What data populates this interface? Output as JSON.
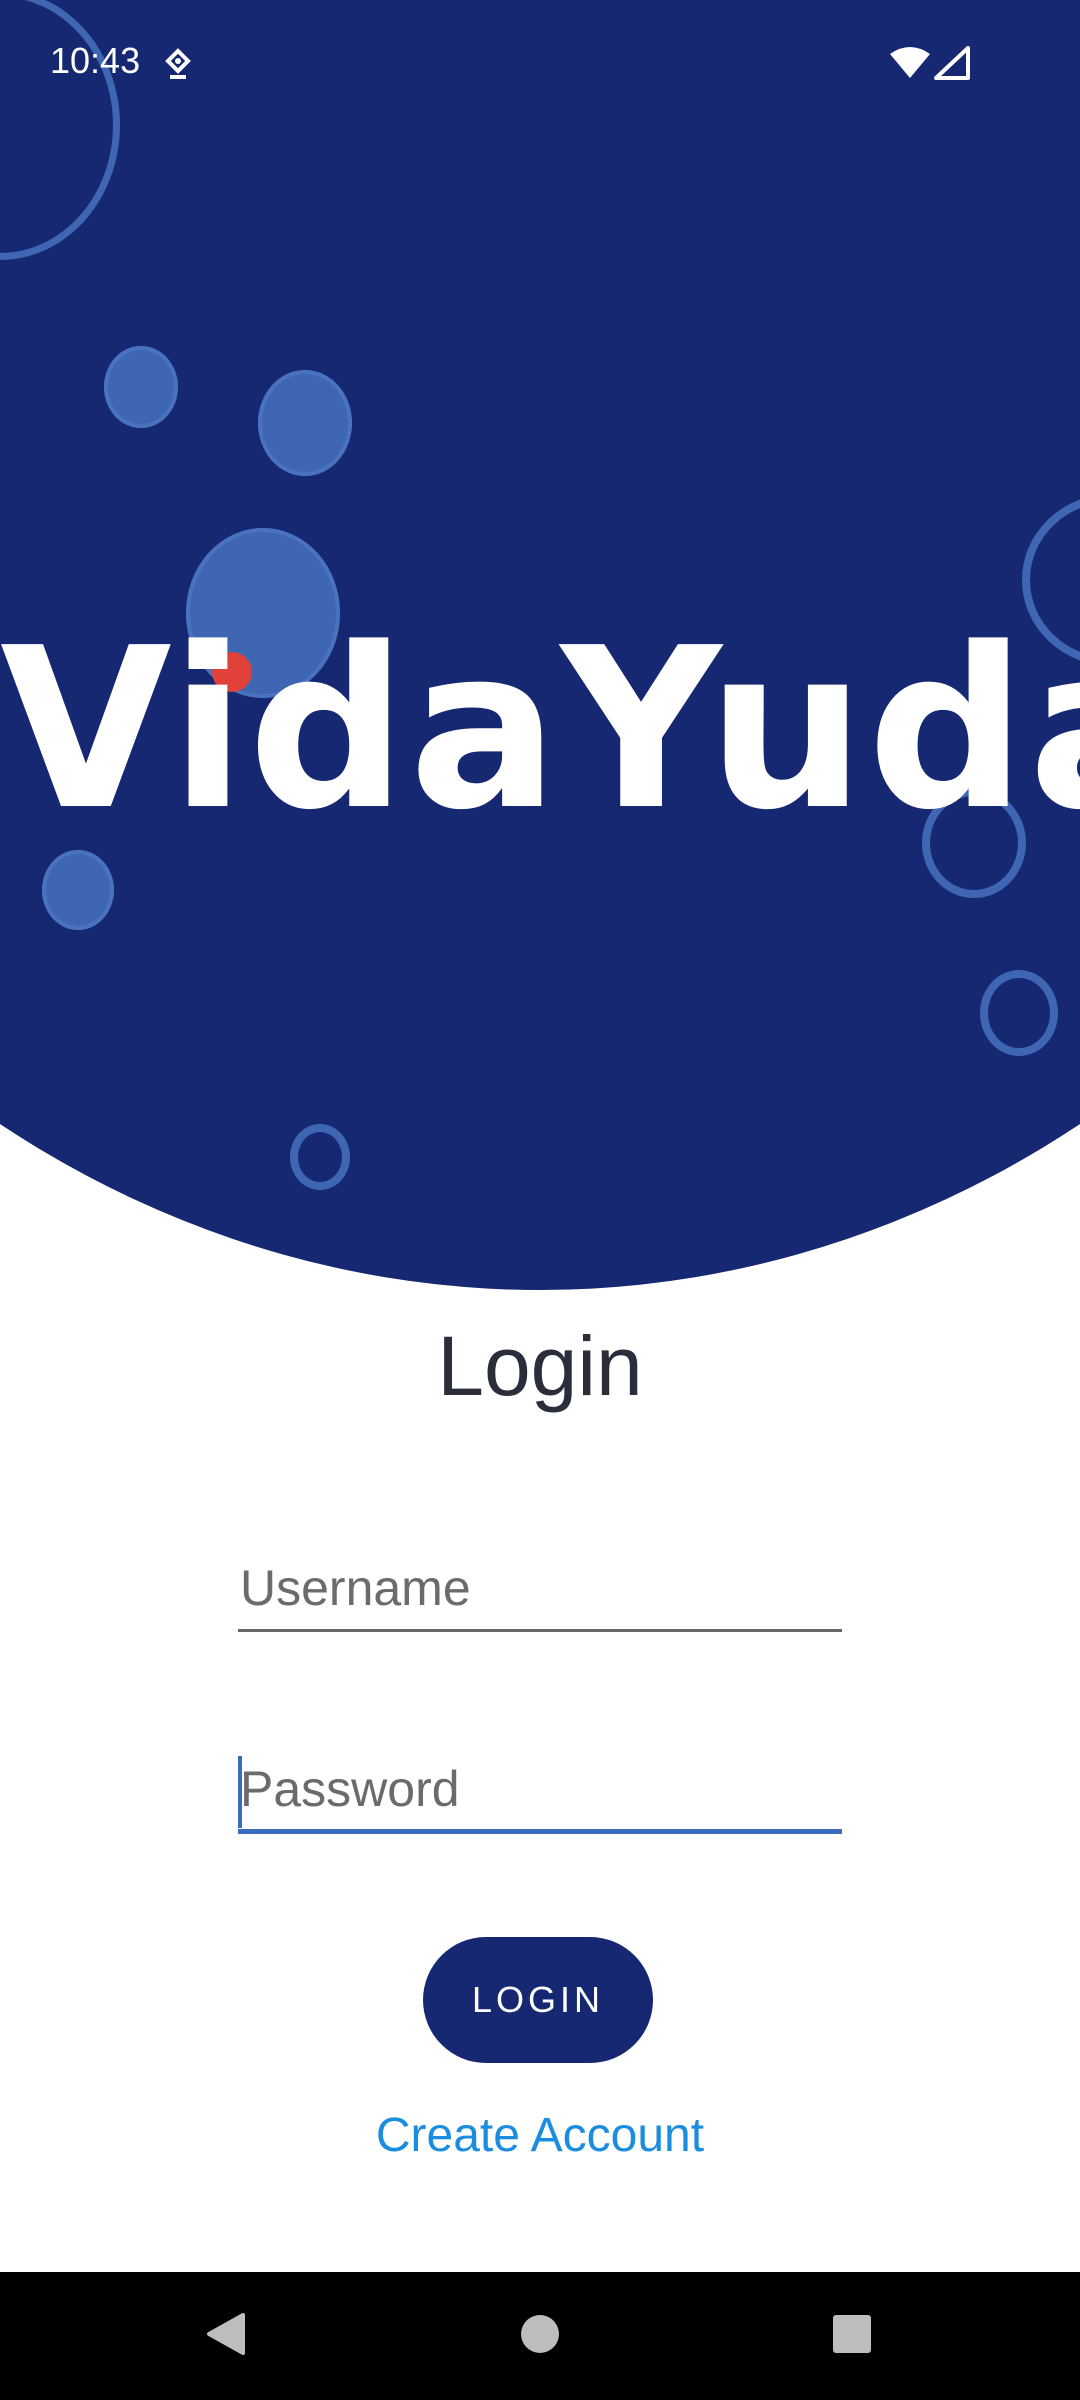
{
  "status_bar": {
    "time": "10:43",
    "notification_icon": "location-pin-icon",
    "wifi_icon": "wifi-icon",
    "signal_icon": "cell-signal-icon"
  },
  "brand": {
    "logo_text": "VidaYuda",
    "primary_color": "#172873",
    "accent_color": "#3f66b3",
    "dot_color": "#e0413b"
  },
  "login": {
    "title": "Login",
    "username_placeholder": "Username",
    "username_value": "",
    "password_placeholder": "Password",
    "password_value": "",
    "login_button_label": "LOGIN",
    "create_account_label": "Create Account",
    "link_color": "#1b8de0"
  },
  "nav_bar": {
    "back_icon": "back-triangle-icon",
    "home_icon": "home-circle-icon",
    "recents_icon": "recents-square-icon"
  }
}
